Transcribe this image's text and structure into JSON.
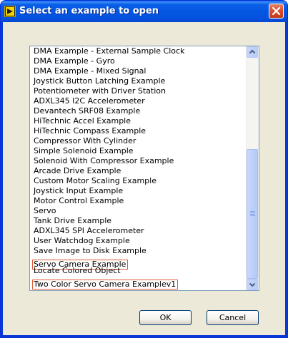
{
  "window": {
    "title": "Select an example to open",
    "icon": "labview-icon",
    "close_icon": "close-icon"
  },
  "list": {
    "items": [
      "DMA Example - External Sample Clock",
      "DMA Example - Gyro",
      "DMA Example - Mixed Signal",
      "Joystick Button Latching Example",
      "Potentiometer with Driver Station",
      "ADXL345 I2C Accelerometer",
      "Devantech SRF08 Example",
      "HiTechnic Accel Example",
      "HiTechnic Compass Example",
      "Compressor With Cylinder",
      "Simple Solenoid Example",
      "Solenoid With Compressor Example",
      "Arcade Drive Example",
      "Custom Motor Scaling Example",
      "Joystick Input Example",
      "Motor Control Example",
      "Servo",
      "Tank Drive Example",
      "ADXL345 SPI Accelerometer",
      "User Watchdog Example",
      "Save Image to Disk Example",
      "Servo Camera Example",
      "Locate Colored Object",
      "Two Color Servo Camera Examplev1"
    ],
    "highlighted": [
      21,
      23
    ],
    "scroll_position": 0.95
  },
  "buttons": {
    "ok": "OK",
    "cancel": "Cancel"
  },
  "colors": {
    "titlebar": "#0456e2",
    "dialog_bg": "#ece9d8",
    "highlight_box": "#e05a3a"
  }
}
